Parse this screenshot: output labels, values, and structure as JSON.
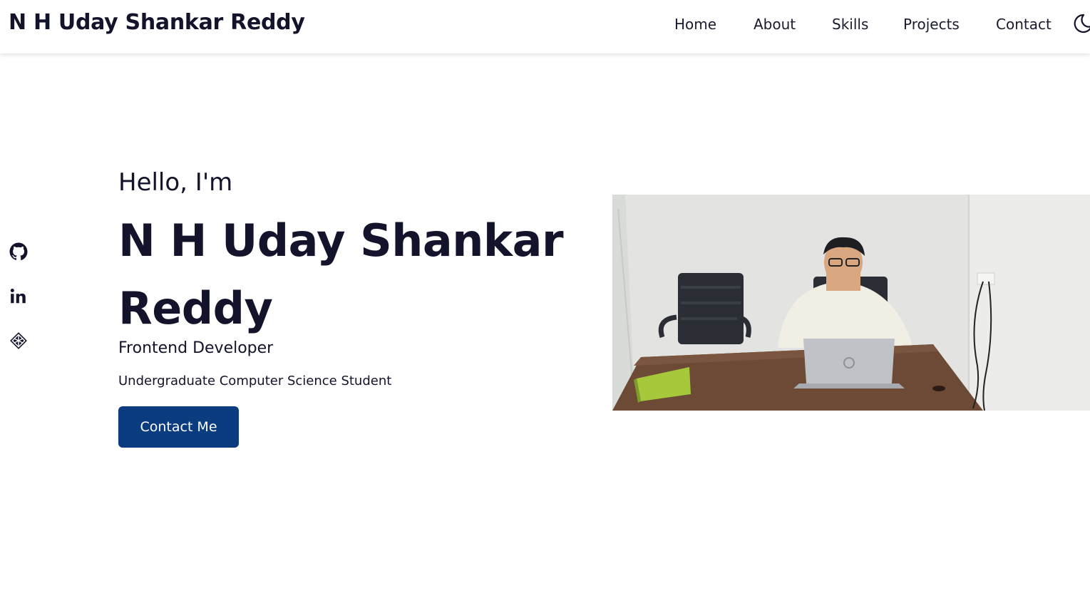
{
  "header": {
    "brand": "N H Uday Shankar Reddy",
    "nav": {
      "home": "Home",
      "about": "About",
      "skills": "Skills",
      "projects": "Projects",
      "contact": "Contact"
    },
    "theme_toggle_icon": "moon-icon"
  },
  "social": {
    "items": [
      {
        "icon": "github-icon"
      },
      {
        "icon": "linkedin-icon"
      },
      {
        "icon": "netlify-icon"
      }
    ]
  },
  "hero": {
    "greeting": "Hello, I'm",
    "name": "N H Uday Shankar Reddy",
    "role": "Frontend Developer",
    "subtitle": "Undergraduate Computer Science Student",
    "cta_label": "Contact Me"
  },
  "colors": {
    "primary_button": "#0b3c7f",
    "text": "#13132b",
    "background": "#ffffff"
  }
}
